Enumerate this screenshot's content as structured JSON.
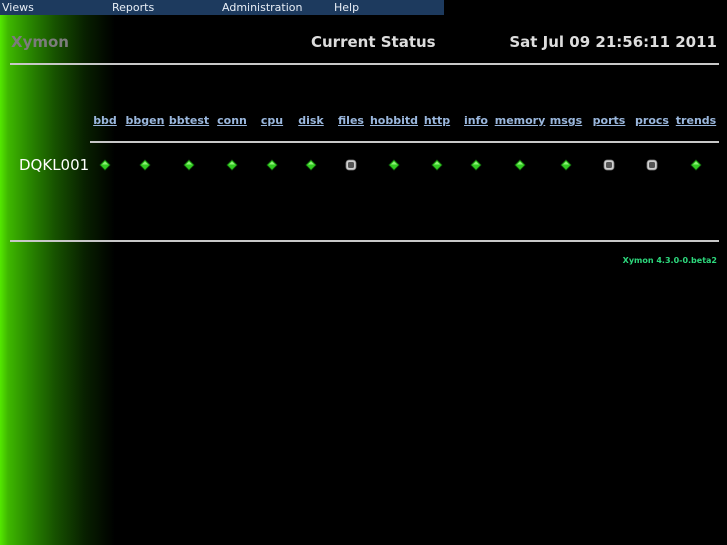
{
  "menu": [
    "Views",
    "Reports",
    "Administration",
    "Help"
  ],
  "header": {
    "app_name": "Xymon",
    "title": "Current Status",
    "timestamp": "Sat Jul 09 21:56:11 2011"
  },
  "columns": [
    "bbd",
    "bbgen",
    "bbtest",
    "conn",
    "cpu",
    "disk",
    "files",
    "hobbitd",
    "http",
    "info",
    "memory",
    "msgs",
    "ports",
    "procs",
    "trends"
  ],
  "hosts": [
    {
      "name": "DQKL001",
      "statuses": [
        "green",
        "green",
        "green",
        "green",
        "green",
        "green",
        "clear",
        "green",
        "green",
        "green",
        "green",
        "green",
        "clear",
        "clear",
        "green"
      ]
    }
  ],
  "footer": {
    "version": "Xymon 4.3.0-0.beta2"
  },
  "colors": {
    "green": "#33cc22",
    "clear": "#d0d0d0"
  }
}
